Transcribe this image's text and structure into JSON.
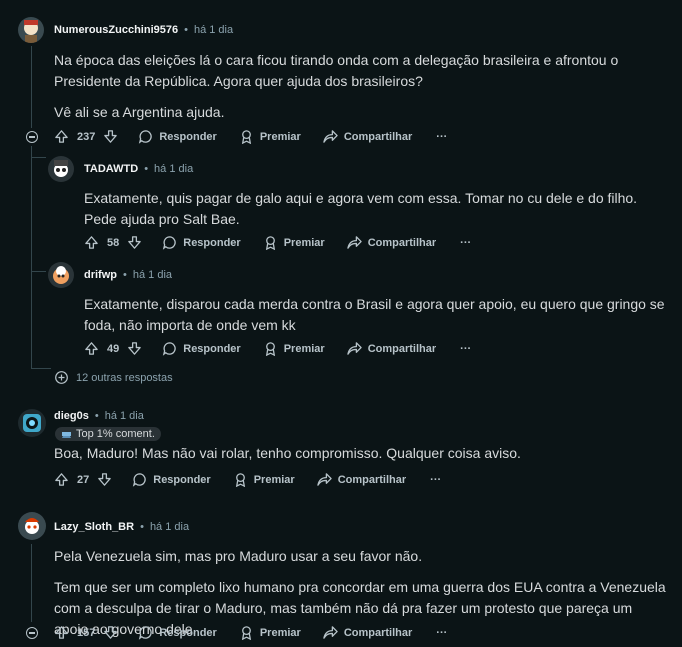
{
  "labels": {
    "reply": "Responder",
    "award": "Premiar",
    "share": "Compartilhar",
    "more": "···"
  },
  "comments": [
    {
      "user": "NumerousZucchini9576",
      "time": "há 1 dia",
      "paragraphs": [
        "Na época das eleições lá o cara ficou tirando onda com a delegação brasileira e afrontou o Presidente da República. Agora quer ajuda dos brasileiros?",
        "Vê ali se a Argentina ajuda."
      ],
      "score": "237"
    },
    {
      "user": "TADAWTD",
      "time": "há 1 dia",
      "paragraphs": [
        "Exatamente, quis pagar de galo aqui e agora vem com essa. Tomar no cu dele e do filho. Pede ajuda pro Salt Bae."
      ],
      "score": "58"
    },
    {
      "user": "drifwp",
      "time": "há 1 dia",
      "paragraphs": [
        "Exatamente, disparou cada merda contra o Brasil e agora quer apoio, eu quero que gringo se foda, não importa de onde vem kk"
      ],
      "score": "49"
    },
    {
      "user": "dieg0s",
      "time": "há 1 dia",
      "badge": "Top 1% coment.",
      "paragraphs": [
        "Boa, Maduro! Mas não vai rolar, tenho compromisso. Qualquer coisa aviso."
      ],
      "score": "27"
    },
    {
      "user": "Lazy_Sloth_BR",
      "time": "há 1 dia",
      "paragraphs": [
        "Pela Venezuela sim, mas pro Maduro usar a seu favor não.",
        "Tem que ser um completo lixo humano pra concordar em uma guerra dos EUA contra a Venezuela com a desculpa de tirar o Maduro, mas também não dá pra fazer um protesto que pareça um apoio ao governo dele."
      ],
      "score": "157"
    }
  ],
  "more_replies": "12 outras respostas"
}
